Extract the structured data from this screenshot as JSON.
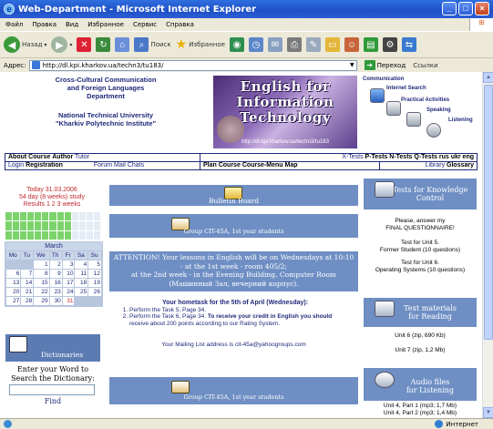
{
  "window": {
    "title": "Web-Department - Microsoft Internet Explorer"
  },
  "menu": {
    "items": [
      "Файл",
      "Правка",
      "Вид",
      "Избранное",
      "Сервис",
      "Справка"
    ]
  },
  "toolbar": {
    "back_label": "Назад",
    "search_label": "Поиск",
    "favorites_label": "Избранное"
  },
  "address": {
    "label": "Адрес:",
    "url": "http://dl.kpi.kharkov.ua/techn3/tu183/",
    "go_label": "Переход",
    "links_label": "Ссылки"
  },
  "status": {
    "zone_label": "Интернет"
  },
  "header": {
    "dept_line1": "Cross-Cultural Communication",
    "dept_line2": "and Foreign Languages",
    "dept_line3": "Department",
    "uni_line1": "National Technical University",
    "uni_line2": "\"Kharkiv Polytechnic Institute\"",
    "banner_line1": "English for",
    "banner_line2": "Information",
    "banner_line3": "Technology",
    "banner_url": "http://dl.kpi.kharkov.ua/techn3/tu183",
    "right_items": [
      "Communication",
      "Internet Search",
      "Practical Activities",
      "Speaking",
      "Listening"
    ]
  },
  "nav": {
    "row1_left": [
      "About Course",
      "Author"
    ],
    "row1_tutor": "Tutor",
    "row1_right_link": "X-Tests",
    "row1_right": [
      "P-Tests",
      "N-Tests",
      "Q-Tests",
      "rus ukr eng"
    ],
    "row2_left": [
      "Login",
      "Registration"
    ],
    "row2_links": [
      "Forum",
      "Mail",
      "Chats"
    ],
    "row2_mid": [
      "Plan Course",
      "Course-Menu",
      "Map"
    ],
    "row2_right_link": "Library",
    "row2_right": "Glossary"
  },
  "left": {
    "today": "Today 31.03.2006",
    "study": "54 day (8 weeks) study",
    "results": "Results 1 2 3 weeks",
    "month": "March",
    "weekdays": [
      "Mo",
      "Tu",
      "We",
      "Th",
      "Fr",
      "Sa",
      "Su"
    ],
    "weeks": [
      [
        "",
        "",
        "1",
        "2",
        "3",
        "4",
        "5"
      ],
      [
        "6",
        "7",
        "8",
        "9",
        "10",
        "11",
        "12"
      ],
      [
        "13",
        "14",
        "15",
        "16",
        "17",
        "18",
        "19"
      ],
      [
        "20",
        "21",
        "22",
        "23",
        "24",
        "25",
        "26"
      ],
      [
        "27",
        "28",
        "29",
        "30",
        "31",
        "",
        ""
      ]
    ],
    "dictionaries_label": "Dictionaries",
    "enter_word": "Enter your Word to",
    "search_dict": "Search the Dictionary:",
    "find_label": "Find"
  },
  "center": {
    "bulletin_label": "Bulletin Board",
    "group_label": "Group CIT-45A, 1st year students",
    "attention_1": "ATTENTION! Your lessons in English will be on Wednesdays at 10:10",
    "attention_2": "- at the 1st week - room 405/2;",
    "attention_3": "at the 2nd week - in the Evening Building, Computer Room",
    "attention_4": "(Машинный Зал, вечерний корпус).",
    "hw_title": "Your hometask for the 5th of April (Wednesday):",
    "hw_1": "Perform the Task 5, Page 34.",
    "hw_2a": "Perform the Task 6, Page 34. ",
    "hw_2b": "To receive your credit in English you should",
    "hw_2c": "receive about 200 points according to our Rating System.",
    "mailing": "Your Mailing List address is cit-45a@yahoogroups.com",
    "group_label_2": "Group CIT-45A, 1st year students"
  },
  "right": {
    "tests_title_1": "Tests for Knowledge",
    "tests_title_2": "Control",
    "answer_1": "Please, answer my",
    "answer_2": "FINAL QUESTIONNAIRE!",
    "test5_1": "Test for Unit 5.",
    "test5_2": "Former Student (10 questions)",
    "test6_1": "Test for Unit 6.",
    "test6_2": "Operating Systems (10 questions)",
    "text_title_1": "Text materials",
    "text_title_2": "for Reading",
    "unit6": "Unit 6 (zip, 690 Kb)",
    "unit7": "Unit 7 (zip, 1,2 Mb)",
    "audio_title_1": "Audio files",
    "audio_title_2": "for Listening",
    "audio1": "Unit 4, Part 1 (mp3; 1,7 Mb)",
    "audio2": "Unit 4, Part 2 (mp3; 1,4 Mb)"
  }
}
